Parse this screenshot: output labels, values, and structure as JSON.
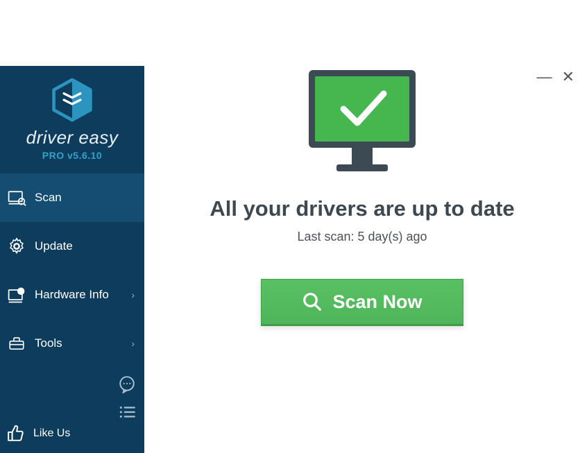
{
  "app": {
    "name": "driver easy",
    "version": "PRO v5.6.10"
  },
  "sidebar": {
    "items": [
      {
        "label": "Scan",
        "has_chevron": false,
        "active": true
      },
      {
        "label": "Update",
        "has_chevron": false,
        "active": false
      },
      {
        "label": "Hardware Info",
        "has_chevron": true,
        "active": false
      },
      {
        "label": "Tools",
        "has_chevron": true,
        "active": false
      }
    ],
    "like_label": "Like Us"
  },
  "main": {
    "headline": "All your drivers are up to date",
    "last_scan": "Last scan: 5 day(s) ago",
    "scan_button": "Scan Now"
  },
  "colors": {
    "sidebar_bg": "#0d3c5c",
    "accent_blue": "#33a1c9",
    "green": "#4fb55a",
    "dark_gray": "#3c4a53"
  }
}
